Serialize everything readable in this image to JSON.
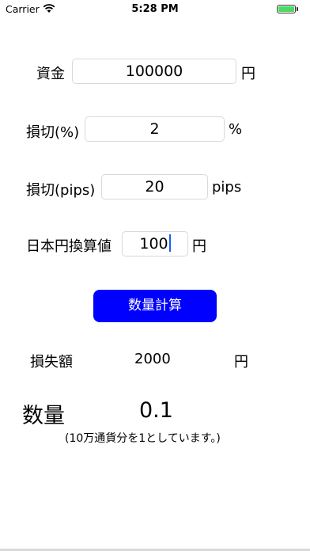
{
  "status_bar": {
    "carrier": "Carrier",
    "time": "5:28 PM"
  },
  "capital": {
    "label": "資金",
    "value": "100000",
    "unit": "円"
  },
  "stop_loss_percent": {
    "label": "損切(%)",
    "value": "2",
    "unit": "%"
  },
  "stop_loss_pips": {
    "label": "損切(pips)",
    "value": "20",
    "unit": "pips"
  },
  "yen_conversion": {
    "label": "日本円換算値",
    "value": "100",
    "unit": "円"
  },
  "calculate_button": {
    "label": "数量計算"
  },
  "loss_amount": {
    "label": "損失額",
    "value": "2000",
    "unit": "円"
  },
  "quantity": {
    "label": "数量",
    "value": "0.1",
    "note": "(10万通貨分を1としています。)"
  }
}
